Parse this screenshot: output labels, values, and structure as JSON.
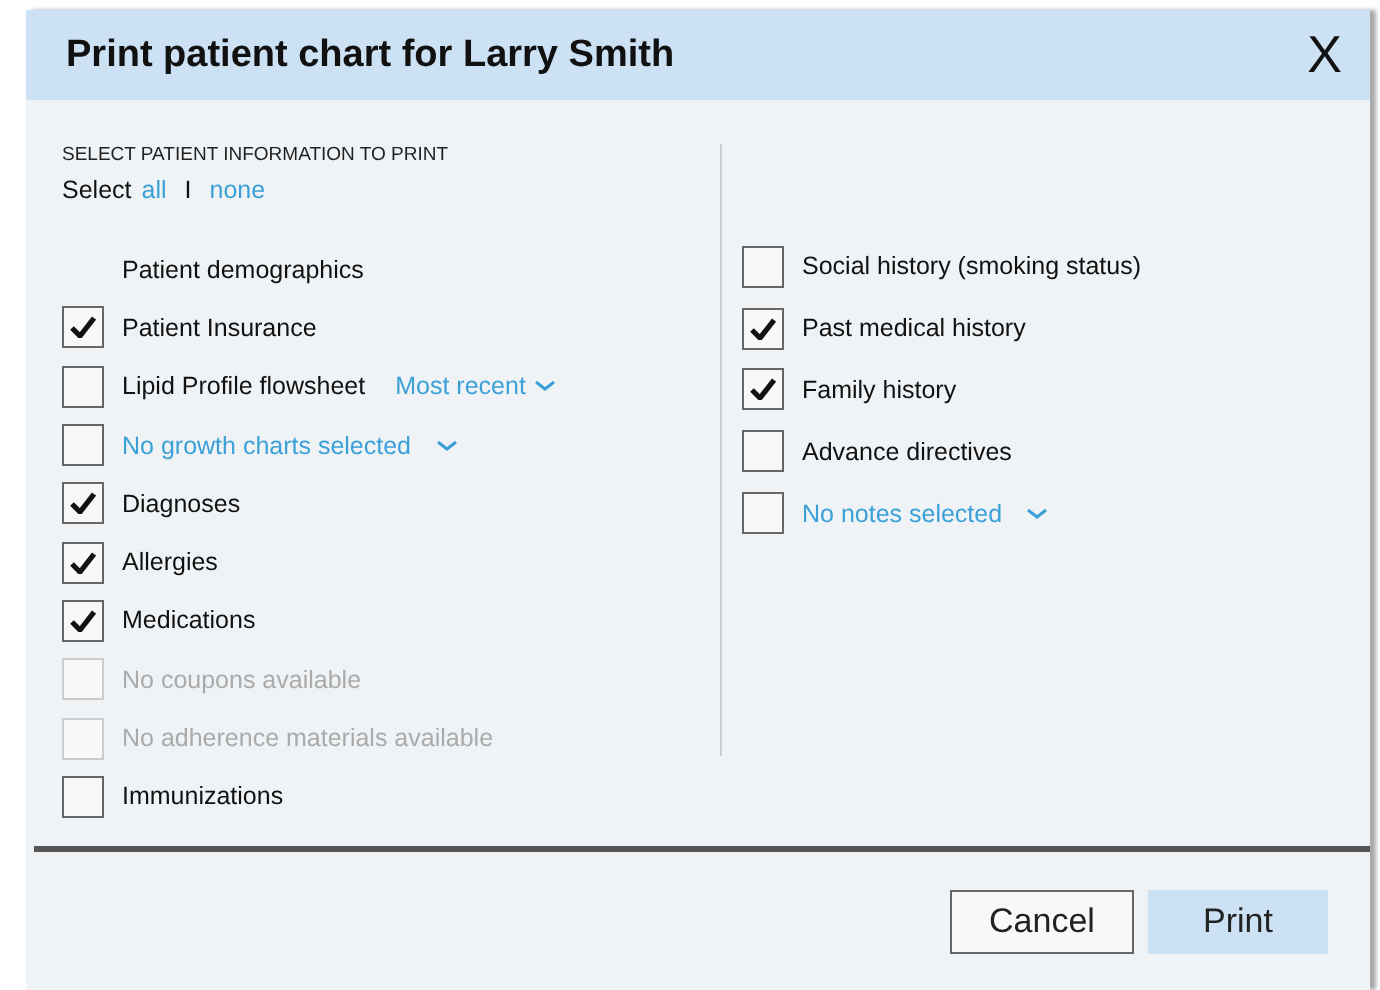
{
  "dialog": {
    "title": "Print patient chart for Larry Smith",
    "close": "X"
  },
  "section": {
    "heading": "SELECT PATIENT INFORMATION TO PRINT",
    "select_label": "Select",
    "select_all": "all",
    "separator": "I",
    "select_none": "none"
  },
  "left_items": [
    {
      "kind": "label",
      "label": "Patient demographics"
    },
    {
      "kind": "check",
      "label": "Patient Insurance",
      "checked": true,
      "disabled": false
    },
    {
      "kind": "check-dropdown",
      "label": "Lipid Profile flowsheet",
      "option": "Most recent",
      "checked": false,
      "disabled": false
    },
    {
      "kind": "dropdown",
      "label": "No growth charts selected",
      "checked": false,
      "disabled": false
    },
    {
      "kind": "check",
      "label": "Diagnoses",
      "checked": true,
      "disabled": false
    },
    {
      "kind": "check",
      "label": "Allergies",
      "checked": true,
      "disabled": false
    },
    {
      "kind": "check",
      "label": "Medications",
      "checked": true,
      "disabled": false
    },
    {
      "kind": "check",
      "label": "No coupons available",
      "checked": false,
      "disabled": true
    },
    {
      "kind": "check",
      "label": "No adherence materials available",
      "checked": false,
      "disabled": true
    },
    {
      "kind": "check",
      "label": "Immunizations",
      "checked": false,
      "disabled": false
    }
  ],
  "right_items": [
    {
      "kind": "check",
      "label": "Social history (smoking status)",
      "checked": false,
      "disabled": false
    },
    {
      "kind": "check",
      "label": "Past medical history",
      "checked": true,
      "disabled": false
    },
    {
      "kind": "check",
      "label": "Family history",
      "checked": true,
      "disabled": false
    },
    {
      "kind": "check",
      "label": "Advance directives",
      "checked": false,
      "disabled": false
    },
    {
      "kind": "dropdown",
      "label": "No notes selected",
      "checked": false,
      "disabled": false
    }
  ],
  "buttons": [
    {
      "label": "Cancel",
      "kind": "secondary"
    },
    {
      "label": "Print",
      "kind": "primary"
    }
  ]
}
